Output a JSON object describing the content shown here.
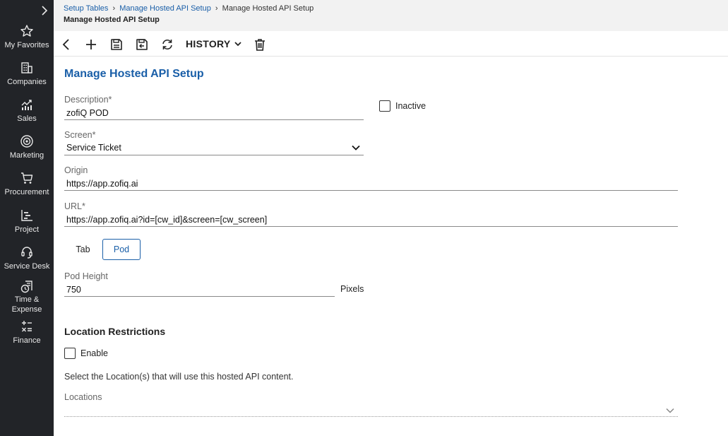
{
  "sidebar": {
    "items": [
      {
        "label": "My Favorites",
        "icon": "star-icon"
      },
      {
        "label": "Companies",
        "icon": "building-icon"
      },
      {
        "label": "Sales",
        "icon": "chart-icon"
      },
      {
        "label": "Marketing",
        "icon": "target-icon"
      },
      {
        "label": "Procurement",
        "icon": "cart-icon"
      },
      {
        "label": "Project",
        "icon": "project-chart-icon"
      },
      {
        "label": "Service Desk",
        "icon": "headset-icon"
      },
      {
        "label": "Time &",
        "label2": "Expense",
        "icon": "clock-receipt-icon"
      },
      {
        "label": "Finance",
        "icon": "calculator-icon"
      }
    ]
  },
  "breadcrumb": {
    "link1": "Setup Tables",
    "link2": "Manage Hosted API Setup",
    "current": "Manage Hosted API Setup"
  },
  "header": {
    "subtitle": "Manage Hosted API Setup"
  },
  "toolbar": {
    "history_label": "HISTORY"
  },
  "form": {
    "title": "Manage Hosted API Setup",
    "description": {
      "label": "Description*",
      "value": "zofiQ POD"
    },
    "inactive_label": "Inactive",
    "screen": {
      "label": "Screen*",
      "value": "Service Ticket"
    },
    "origin": {
      "label": "Origin",
      "value": "https://app.zofiq.ai"
    },
    "url": {
      "label": "URL*",
      "value": "https://app.zofiq.ai?id=[cw_id]&screen=[cw_screen]"
    },
    "display_toggle": {
      "tab_label": "Tab",
      "pod_label": "Pod",
      "selected": "Pod"
    },
    "pod_height": {
      "label": "Pod Height",
      "value": "750",
      "unit": "Pixels"
    },
    "location": {
      "section_title": "Location Restrictions",
      "enable_label": "Enable",
      "help_text": "Select the Location(s) that will use this hosted API content.",
      "locations_label": "Locations"
    }
  },
  "colors": {
    "sidebar_bg": "#222428",
    "accent": "#1a5fa8",
    "header_bg": "#f2f2f2"
  }
}
